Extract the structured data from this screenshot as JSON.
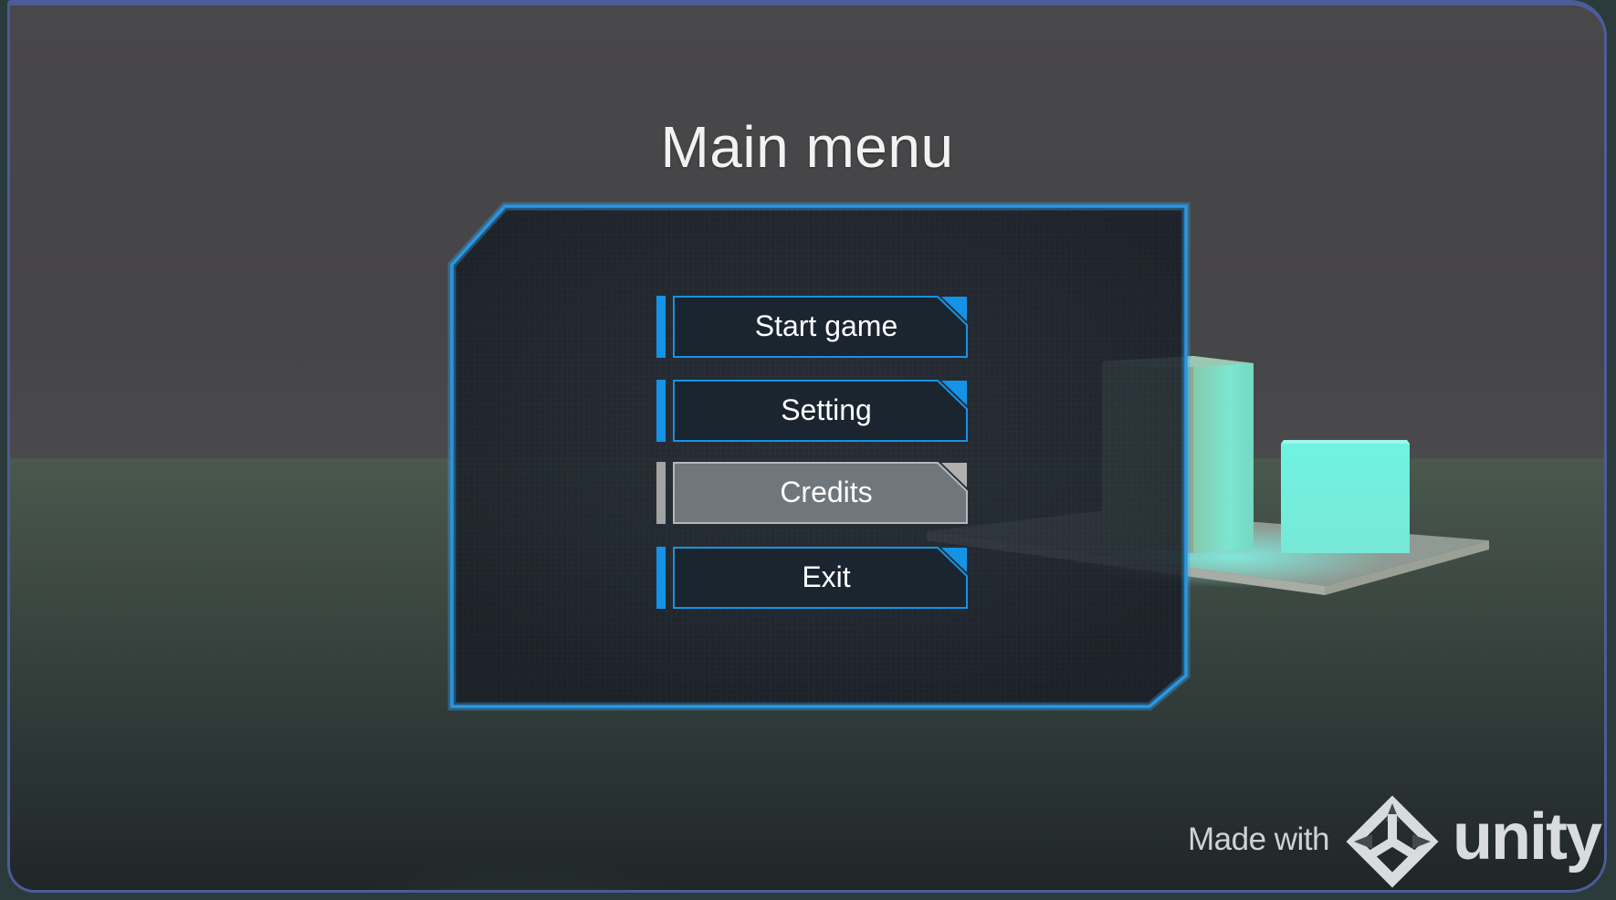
{
  "title": "Main menu",
  "menu": {
    "items": [
      {
        "label": "Start game",
        "state": "normal"
      },
      {
        "label": "Setting",
        "state": "normal"
      },
      {
        "label": "Credits",
        "state": "highlighted"
      },
      {
        "label": "Exit",
        "state": "normal"
      }
    ]
  },
  "branding": {
    "made_with": "Made with",
    "engine": "unity"
  },
  "colors": {
    "accent": "#1593e6",
    "panel_border": "#1c8fe0",
    "highlight_fill": "#6f767c",
    "highlight_accent": "#a3a3a3",
    "glow_cube": "#58e8d6"
  }
}
